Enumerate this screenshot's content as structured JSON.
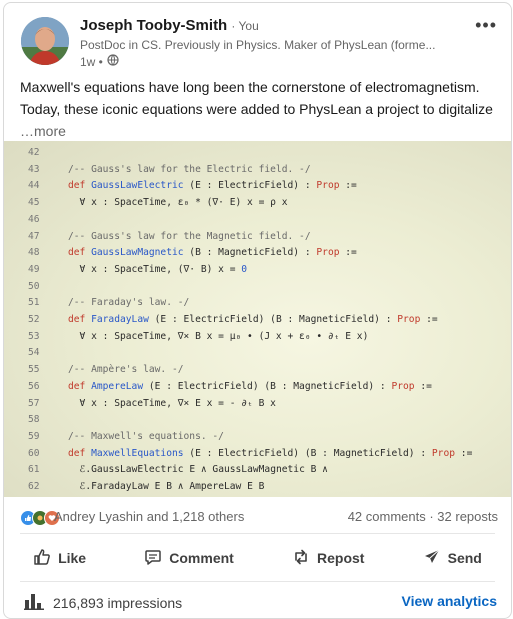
{
  "author": {
    "name": "Joseph Tooby-Smith",
    "you_label": "· You",
    "headline": "PostDoc in CS. Previously in Physics. Maker of PhysLean (forme...",
    "time": "1w •"
  },
  "post": {
    "text": "Maxwell's equations have long been the cornerstone of electromagnetism. Today, these iconic equations were added to PhysLean a project to digitalize",
    "see_more": "…more"
  },
  "code_lines": [
    {
      "n": "42",
      "t": ""
    },
    {
      "n": "43",
      "t": "/-- Gauss's law for the Electric field. -/"
    },
    {
      "n": "44",
      "t": "def GaussLawElectric (E : ElectricField) : Prop :="
    },
    {
      "n": "45",
      "t": "  ∀ x : SpaceTime, ε₀ * (∇· E) x = ρ x"
    },
    {
      "n": "46",
      "t": ""
    },
    {
      "n": "47",
      "t": "/-- Gauss's law for the Magnetic field. -/"
    },
    {
      "n": "48",
      "t": "def GaussLawMagnetic (B : MagneticField) : Prop :="
    },
    {
      "n": "49",
      "t": "  ∀ x : SpaceTime, (∇· B) x = 0"
    },
    {
      "n": "50",
      "t": ""
    },
    {
      "n": "51",
      "t": "/-- Faraday's law. -/"
    },
    {
      "n": "52",
      "t": "def FaradayLaw (E : ElectricField) (B : MagneticField) : Prop :="
    },
    {
      "n": "53",
      "t": "  ∀ x : SpaceTime, ∇× B x = μ₀ • (J x + ε₀ • ∂ₜ E x)"
    },
    {
      "n": "54",
      "t": ""
    },
    {
      "n": "55",
      "t": "/-- Ampère's law. -/"
    },
    {
      "n": "56",
      "t": "def AmpereLaw (E : ElectricField) (B : MagneticField) : Prop :="
    },
    {
      "n": "57",
      "t": "  ∀ x : SpaceTime, ∇× E x = - ∂ₜ B x"
    },
    {
      "n": "58",
      "t": ""
    },
    {
      "n": "59",
      "t": "/-- Maxwell's equations. -/"
    },
    {
      "n": "60",
      "t": "def MaxwellEquations (E : ElectricField) (B : MagneticField) : Prop :="
    },
    {
      "n": "61",
      "t": "  ℰ.GaussLawElectric E ∧ GaussLawMagnetic B ∧"
    },
    {
      "n": "62",
      "t": "  ℰ.FaradayLaw E B ∧ AmpereLaw E B"
    }
  ],
  "social": {
    "reactions_text": "Andrey Lyashin and 1,218 others",
    "comments_reposts": "42 comments · 32 reposts"
  },
  "actions": {
    "like": "Like",
    "comment": "Comment",
    "repost": "Repost",
    "send": "Send"
  },
  "analytics": {
    "impressions": "216,893 impressions",
    "view_label": "View analytics"
  },
  "colors": {
    "link": "#0a66c2",
    "code_keyword": "#c0392b",
    "code_function": "#2957c8"
  }
}
